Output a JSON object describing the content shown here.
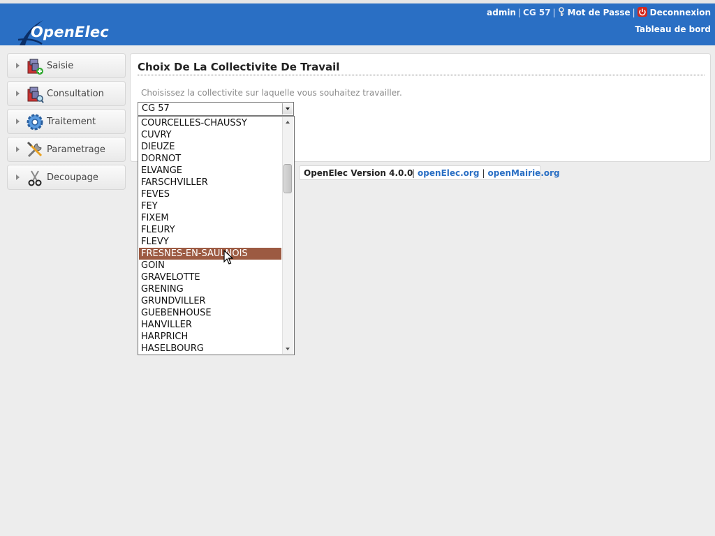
{
  "header": {
    "logo_text": "OpenElec",
    "user": "admin",
    "collectivite": "CG 57",
    "password_link": "Mot de Passe",
    "logout_link": "Deconnexion",
    "dashboard_link": "Tableau de bord",
    "separator": "|",
    "background_color": "#2a6fc4"
  },
  "menu": {
    "items": [
      {
        "label": "Saisie",
        "icon": "saisie-icon"
      },
      {
        "label": "Consultation",
        "icon": "consultation-icon"
      },
      {
        "label": "Traitement",
        "icon": "traitement-icon"
      },
      {
        "label": "Parametrage",
        "icon": "parametrage-icon"
      },
      {
        "label": "Decoupage",
        "icon": "decoupage-icon"
      }
    ]
  },
  "main": {
    "title": "Choix De La Collectivite De Travail",
    "instructions": "Choisissez la collectivite sur laquelle vous souhaitez travailler.",
    "select": {
      "value": "CG 57",
      "options": [
        "COURCELLES-CHAUSSY",
        "CUVRY",
        "DIEUZE",
        "DORNOT",
        "ELVANGE",
        "FARSCHVILLER",
        "FEVES",
        "FEY",
        "FIXEM",
        "FLEURY",
        "FLEVY",
        "FRESNES-EN-SAULNOIS",
        "GOIN",
        "GRAVELOTTE",
        "GRENING",
        "GRUNDVILLER",
        "GUEBENHOUSE",
        "HANVILLER",
        "HARPRICH",
        "HASELBOURG"
      ],
      "highlighted": "FRESNES-EN-SAULNOIS",
      "highlight_color": "#9c5a42"
    }
  },
  "footer": {
    "version": "OpenElec Version 4.0.0",
    "links": [
      "openElec.org",
      "openMairie.org"
    ],
    "separator": "|"
  }
}
